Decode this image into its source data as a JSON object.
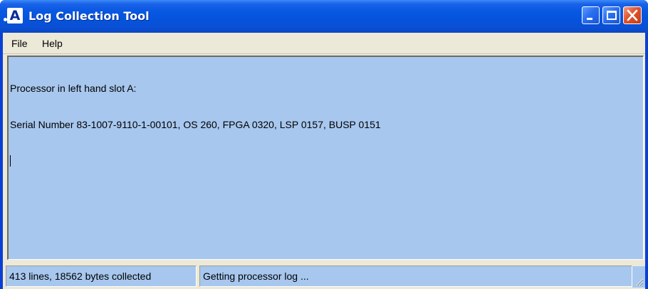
{
  "window": {
    "title": "Log Collection Tool",
    "app_icon_letter": "A",
    "controls": [
      "minimize",
      "maximize",
      "close"
    ],
    "colors": {
      "titlebar": "#0553dc",
      "close_button": "#e1532d",
      "log_background": "#a7c7ee"
    }
  },
  "menu": {
    "items": [
      {
        "label": "File"
      },
      {
        "label": "Help"
      }
    ]
  },
  "log": {
    "lines": [
      "Processor in left hand slot A:",
      "Serial Number 83-1007-9110-1-00101, OS 260, FPGA 0320, LSP 0157, BUSP 0151"
    ]
  },
  "status": {
    "collected": "413 lines, 18562 bytes collected",
    "message": "Getting processor log ..."
  }
}
